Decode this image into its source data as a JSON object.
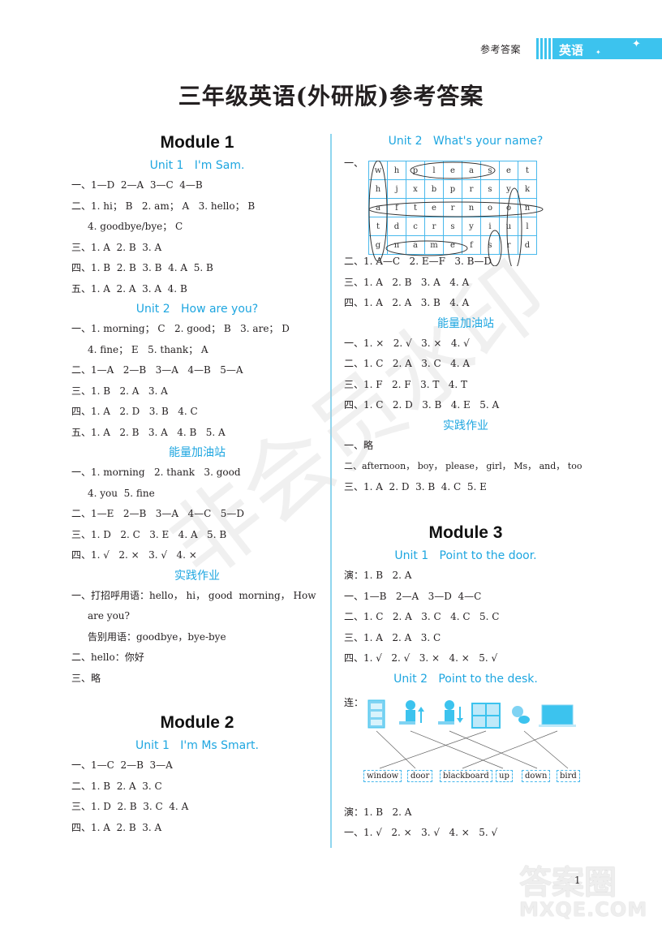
{
  "header": {
    "label": "参考答案",
    "subject": "英语",
    "title": "三年级英语(外研版)参考答案"
  },
  "watermark": "非会员水印",
  "left": {
    "m1": {
      "module": "Module 1",
      "u1": {
        "title": "Unit 1   I'm Sam.",
        "lines": [
          "一、1—D  2—A  3—C  4—B",
          "二、1. hi； B   2. am； A   3. hello； B",
          "4. goodbye/bye； C",
          "三、1. A  2. B  3. A",
          "四、1. B  2. B  3. B  4. A  5. B",
          "五、1. A  2. A  3. A  4. B"
        ]
      },
      "u2": {
        "title": "Unit 2   How are you?",
        "lines": [
          "一、1. morning； C   2. good； B   3. are； D",
          "4. fine； E   5. thank； A",
          "二、1—A   2—B   3—A   4—B   5—A",
          "三、1. B   2. A   3. A",
          "四、1. A   2. D   3. B   4. C",
          "五、1. A   2. B   3. A   4. B   5. A"
        ]
      },
      "energy": {
        "title": "能量加油站",
        "lines": [
          "一、1. morning   2. thank   3. good",
          "4. you  5. fine",
          "二、1—E   2—B   3—A   4—C   5—D",
          "三、1. D   2. C   3. E   4. A   5. B",
          "四、1. √   2. ×   3. √   4. ×"
        ]
      },
      "practice": {
        "title": "实践作业",
        "lines": [
          "一、打招呼用语：hello， hi， good  morning， How",
          "are you?",
          "告别用语：goodbye，bye-bye",
          "二、hello：你好",
          "三、略"
        ]
      }
    },
    "m2": {
      "module": "Module 2",
      "u1": {
        "title": "Unit 1   I'm Ms Smart.",
        "lines": [
          "一、1—C  2—B  3—A",
          "二、1. B  2. A  3. C",
          "三、1. D  2. B  3. C  4. A",
          "四、1. A  2. B  3. A"
        ]
      }
    }
  },
  "right": {
    "m2u2": {
      "title": "Unit 2   What's your name?",
      "q_label": "一、",
      "grid": [
        [
          "w",
          "h",
          "p",
          "l",
          "e",
          "a",
          "s",
          "e",
          "t"
        ],
        [
          "h",
          "j",
          "x",
          "b",
          "p",
          "r",
          "s",
          "y",
          "k"
        ],
        [
          "a",
          "f",
          "t",
          "e",
          "r",
          "n",
          "o",
          "o",
          "n"
        ],
        [
          "t",
          "d",
          "c",
          "r",
          "s",
          "y",
          "i",
          "u",
          "l"
        ],
        [
          "g",
          "n",
          "a",
          "m",
          "e",
          "f",
          "s",
          "r",
          "d"
        ]
      ],
      "circled_words": [
        "what",
        "please",
        "afternoon",
        "your",
        "is",
        "name"
      ],
      "lines": [
        "二、1. A—C   2. E—F   3. B—D",
        "三、1. A   2. B   3. A   4. A",
        "四、1. A   2. A   3. B   4. A"
      ]
    },
    "energy": {
      "title": "能量加油站",
      "lines": [
        "一、1. ×   2. √   3. ×   4. √",
        "二、1. C   2. A   3. C   4. A",
        "三、1. F   2. F   3. T   4. T",
        "四、1. C   2. D   3. B   4. E   5. A"
      ]
    },
    "practice": {
      "title": "实践作业",
      "lines": [
        "一、略",
        "二、afternoon， boy， please， girl， Ms， and， too",
        "三、1. A  2. D  3. B  4. C  5. E"
      ]
    },
    "m3": {
      "module": "Module 3",
      "u1": {
        "title": "Unit 1   Point to the door.",
        "lines": [
          "演：1. B   2. A",
          "一、1—B   2—A   3—D  4—C",
          "二、1. C   2. A   3. C   4. C   5. C",
          "三、1. A   2. A   3. C",
          "四、1. √   2. √   3. ×   4. ×   5. √"
        ]
      },
      "u2": {
        "title": "Unit 2   Point to the desk.",
        "match_label": "连：",
        "pictures": [
          "door-icon",
          "stand-up-icon",
          "sit-down-icon",
          "window-icon",
          "bird-icon",
          "blackboard-icon"
        ],
        "words": [
          "window",
          "door",
          "blackboard",
          "up",
          "down",
          "bird"
        ],
        "lines": [
          "演：1. B   2. A",
          "一、1. √   2. ×   3. √   4. ×   5. √"
        ]
      }
    }
  },
  "footer": {
    "page_number": "1",
    "site_mark_line1": "答案圈",
    "site_mark_line2": "MXQE.COM"
  }
}
